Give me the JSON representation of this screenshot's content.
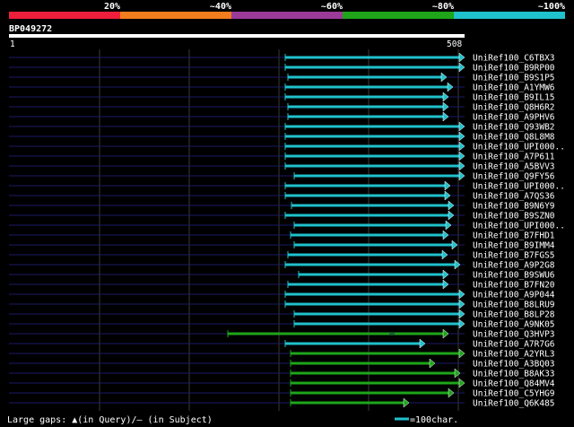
{
  "legend": {
    "segments": [
      {
        "color": "#ee1f3b",
        "label": "20%"
      },
      {
        "color": "#f27d1d",
        "label": "~40%"
      },
      {
        "color": "#9b3a99",
        "label": "~60%"
      },
      {
        "color": "#1ea51a",
        "label": "~80%"
      },
      {
        "color": "#1fc1cc",
        "label": "~100%"
      }
    ]
  },
  "query": {
    "name": "BP049272",
    "start_label": "1",
    "end_label": "508",
    "length": 508
  },
  "hits": [
    {
      "name": "UniRef100_C6TBX3",
      "start": 308,
      "end": 508,
      "tier": 5
    },
    {
      "name": "UniRef100_B9RP00",
      "start": 308,
      "end": 508,
      "tier": 5
    },
    {
      "name": "UniRef100_B9S1P5",
      "start": 311,
      "end": 488,
      "tier": 5
    },
    {
      "name": "UniRef100_A1YMW6",
      "start": 308,
      "end": 495,
      "tier": 5
    },
    {
      "name": "UniRef100_B9IL15",
      "start": 308,
      "end": 490,
      "tier": 5
    },
    {
      "name": "UniRef100_Q8H6R2",
      "start": 311,
      "end": 490,
      "tier": 5
    },
    {
      "name": "UniRef100_A9PHV6",
      "start": 311,
      "end": 490,
      "tier": 5
    },
    {
      "name": "UniRef100_Q93WB2",
      "start": 308,
      "end": 508,
      "tier": 5
    },
    {
      "name": "UniRef100_Q8L8M8",
      "start": 308,
      "end": 508,
      "tier": 5
    },
    {
      "name": "UniRef100_UPI000..",
      "start": 308,
      "end": 508,
      "tier": 5
    },
    {
      "name": "UniRef100_A7P611",
      "start": 308,
      "end": 508,
      "tier": 5
    },
    {
      "name": "UniRef100_A5BVV3",
      "start": 308,
      "end": 508,
      "tier": 5
    },
    {
      "name": "UniRef100_Q9FY56",
      "start": 318,
      "end": 508,
      "tier": 5
    },
    {
      "name": "UniRef100_UPI000..",
      "start": 308,
      "end": 492,
      "tier": 5
    },
    {
      "name": "UniRef100_A7QS36",
      "start": 308,
      "end": 492,
      "tier": 5
    },
    {
      "name": "UniRef100_B9N6Y9",
      "start": 315,
      "end": 496,
      "tier": 5
    },
    {
      "name": "UniRef100_B9SZN0",
      "start": 308,
      "end": 496,
      "tier": 5
    },
    {
      "name": "UniRef100_UPI000..",
      "start": 318,
      "end": 493,
      "tier": 5
    },
    {
      "name": "UniRef100_B7FHD1",
      "start": 314,
      "end": 490,
      "tier": 5
    },
    {
      "name": "UniRef100_B9IMM4",
      "start": 318,
      "end": 500,
      "tier": 5
    },
    {
      "name": "UniRef100_B7FGS5",
      "start": 311,
      "end": 489,
      "tier": 5
    },
    {
      "name": "UniRef100_A9P2G8",
      "start": 308,
      "end": 503,
      "tier": 5
    },
    {
      "name": "UniRef100_B9SWU6",
      "start": 323,
      "end": 490,
      "tier": 5
    },
    {
      "name": "UniRef100_B7FN20",
      "start": 311,
      "end": 490,
      "tier": 5
    },
    {
      "name": "UniRef100_A9P044",
      "start": 308,
      "end": 508,
      "tier": 5
    },
    {
      "name": "UniRef100_B8LRU9",
      "start": 308,
      "end": 508,
      "tier": 5
    },
    {
      "name": "UniRef100_B8LP28",
      "start": 318,
      "end": 508,
      "tier": 5
    },
    {
      "name": "UniRef100_A9NK05",
      "start": 318,
      "end": 508,
      "tier": 5
    },
    {
      "name": "UniRef100_Q3HVP3",
      "start": 244,
      "end": 490,
      "tier": 4,
      "gap": [
        424,
        430
      ]
    },
    {
      "name": "UniRef100_A7R7G6",
      "start": 308,
      "end": 464,
      "tier": 5
    },
    {
      "name": "UniRef100_A2YRL3",
      "start": 314,
      "end": 508,
      "tier": 4
    },
    {
      "name": "UniRef100_A3BQ03",
      "start": 314,
      "end": 475,
      "tier": 4
    },
    {
      "name": "UniRef100_B8AK33",
      "start": 314,
      "end": 503,
      "tier": 4
    },
    {
      "name": "UniRef100_Q84MV4",
      "start": 314,
      "end": 508,
      "tier": 4
    },
    {
      "name": "UniRef100_C5YHG9",
      "start": 314,
      "end": 496,
      "tier": 4
    },
    {
      "name": "UniRef100_Q6K485",
      "start": 314,
      "end": 446,
      "tier": 4
    }
  ],
  "footer": {
    "gaps_text": "Large gaps: ▲(in Query)/— (in Subject)",
    "scale_text": "=100char."
  }
}
